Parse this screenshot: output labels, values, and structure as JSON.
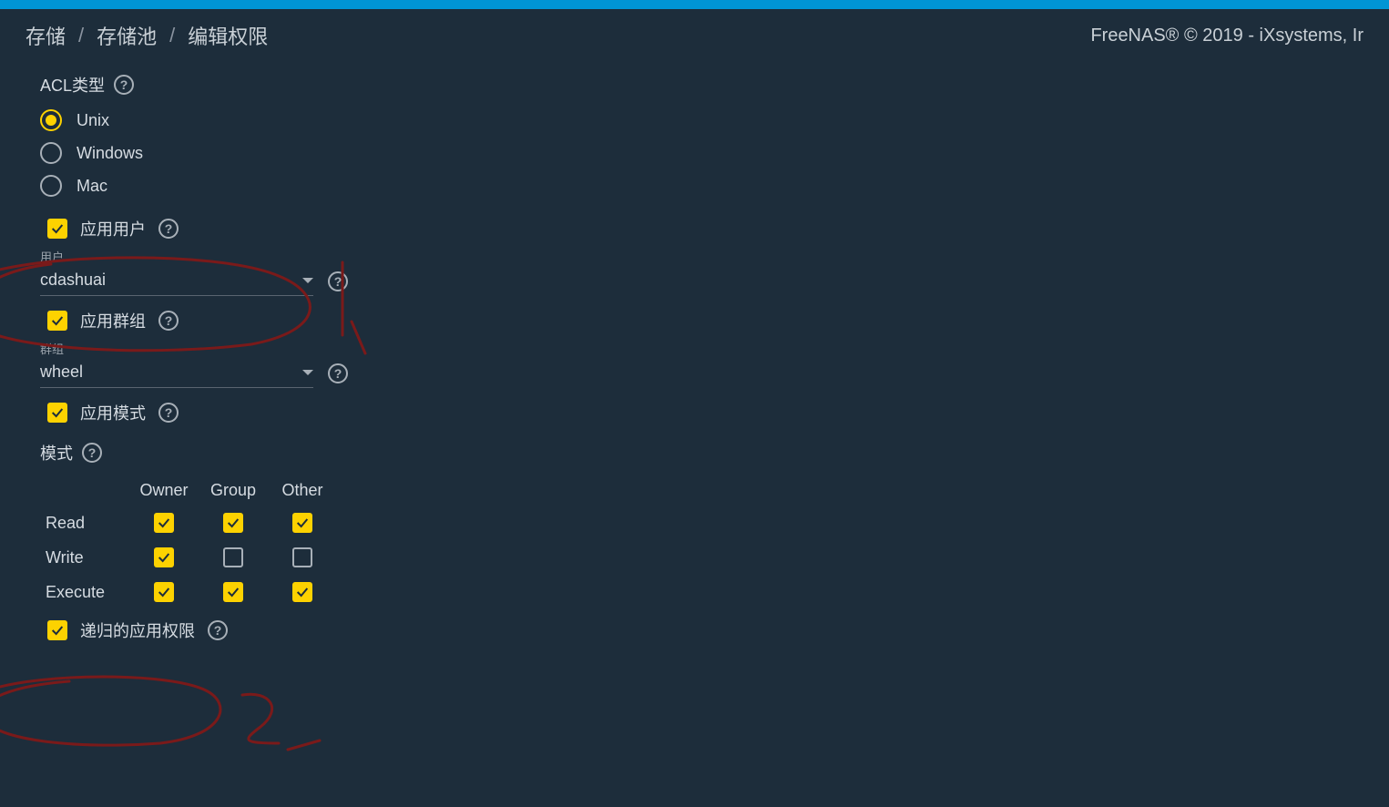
{
  "header": {
    "breadcrumb": [
      "存储",
      "存储池",
      "编辑权限"
    ],
    "right": "FreeNAS® © 2019 - iXsystems, Ir"
  },
  "acl": {
    "label": "ACL类型",
    "options": [
      "Unix",
      "Windows",
      "Mac"
    ],
    "selected": "Unix"
  },
  "applyUser": {
    "label": "应用用户",
    "checked": true
  },
  "user": {
    "label": "用户",
    "value": "cdashuai"
  },
  "applyGroup": {
    "label": "应用群组",
    "checked": true
  },
  "group": {
    "label": "群组",
    "value": "wheel"
  },
  "applyMode": {
    "label": "应用模式",
    "checked": true
  },
  "mode": {
    "label": "模式",
    "cols": [
      "Owner",
      "Group",
      "Other"
    ],
    "rows": [
      "Read",
      "Write",
      "Execute"
    ],
    "values": {
      "Read": {
        "Owner": true,
        "Group": true,
        "Other": true
      },
      "Write": {
        "Owner": true,
        "Group": false,
        "Other": false
      },
      "Execute": {
        "Owner": true,
        "Group": true,
        "Other": true
      }
    }
  },
  "recursive": {
    "label": "递归的应用权限",
    "checked": true
  }
}
